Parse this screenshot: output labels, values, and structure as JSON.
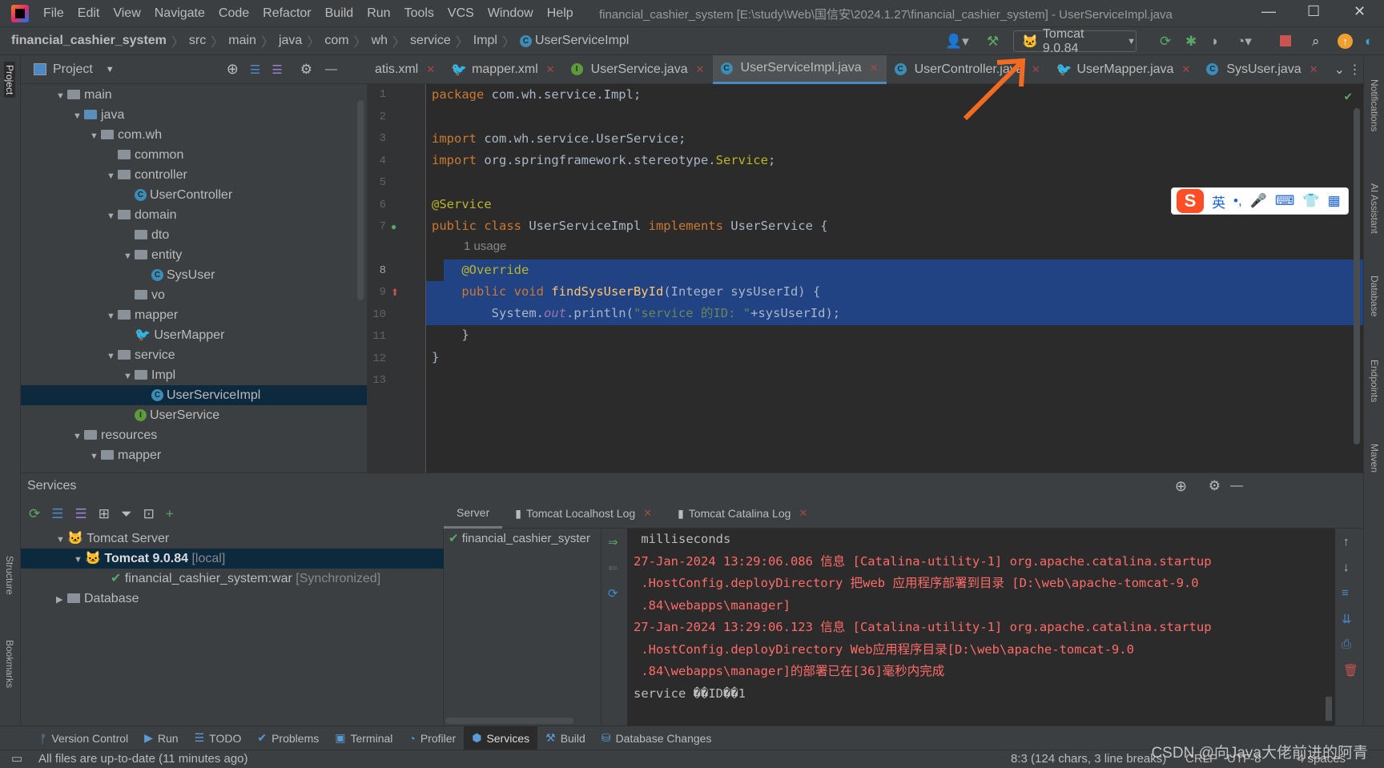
{
  "window": {
    "title": "financial_cashier_system [E:\\study\\Web\\国信安\\2024.1.27\\financial_cashier_system] - UserServiceImpl.java"
  },
  "menu": [
    "File",
    "Edit",
    "View",
    "Navigate",
    "Code",
    "Refactor",
    "Build",
    "Run",
    "Tools",
    "VCS",
    "Window",
    "Help"
  ],
  "breadcrumb": [
    "financial_cashier_system",
    "src",
    "main",
    "java",
    "com",
    "wh",
    "service",
    "Impl",
    "UserServiceImpl"
  ],
  "run_config": "Tomcat 9.0.84",
  "project_panel": {
    "title": "Project",
    "tree": [
      {
        "label": "main",
        "depth": 0,
        "type": "folder",
        "open": true
      },
      {
        "label": "java",
        "depth": 1,
        "type": "folder-blue",
        "open": true
      },
      {
        "label": "com.wh",
        "depth": 2,
        "type": "folder",
        "open": true
      },
      {
        "label": "common",
        "depth": 3,
        "type": "folder"
      },
      {
        "label": "controller",
        "depth": 3,
        "type": "folder",
        "open": true
      },
      {
        "label": "UserController",
        "depth": 4,
        "type": "class"
      },
      {
        "label": "domain",
        "depth": 3,
        "type": "folder",
        "open": true
      },
      {
        "label": "dto",
        "depth": 4,
        "type": "folder"
      },
      {
        "label": "entity",
        "depth": 4,
        "type": "folder",
        "open": true
      },
      {
        "label": "SysUser",
        "depth": 5,
        "type": "class"
      },
      {
        "label": "vo",
        "depth": 4,
        "type": "folder"
      },
      {
        "label": "mapper",
        "depth": 3,
        "type": "folder",
        "open": true
      },
      {
        "label": "UserMapper",
        "depth": 4,
        "type": "mybatis"
      },
      {
        "label": "service",
        "depth": 3,
        "type": "folder",
        "open": true
      },
      {
        "label": "Impl",
        "depth": 4,
        "type": "folder",
        "open": true
      },
      {
        "label": "UserServiceImpl",
        "depth": 5,
        "type": "class",
        "selected": true
      },
      {
        "label": "UserService",
        "depth": 4,
        "type": "interface"
      },
      {
        "label": "resources",
        "depth": 1,
        "type": "folder",
        "open": true
      },
      {
        "label": "mapper",
        "depth": 2,
        "type": "folder",
        "open": true
      }
    ]
  },
  "editor_tabs": [
    {
      "label": "atis.xml",
      "icon": "xml"
    },
    {
      "label": "mapper.xml",
      "icon": "mybatis"
    },
    {
      "label": "UserService.java",
      "icon": "interface"
    },
    {
      "label": "UserServiceImpl.java",
      "icon": "class",
      "active": true
    },
    {
      "label": "UserController.java",
      "icon": "class"
    },
    {
      "label": "UserMapper.java",
      "icon": "mybatis"
    },
    {
      "label": "SysUser.java",
      "icon": "class"
    }
  ],
  "code": {
    "usage_hint": "1 usage",
    "lines": [
      "1",
      "2",
      "3",
      "4",
      "5",
      "6",
      "7",
      "8",
      "9",
      "10",
      "11",
      "12",
      "13"
    ]
  },
  "ime": {
    "lang": "英",
    "punct": "•,"
  },
  "services": {
    "title": "Services",
    "tree": {
      "server": "Tomcat Server",
      "instance": "Tomcat 9.0.84",
      "instance_tag": "[local]",
      "artifact": "financial_cashier_system:war",
      "artifact_tag": "[Synchronized]",
      "database": "Database"
    },
    "tabs": [
      "Server",
      "Tomcat Localhost Log",
      "Tomcat Catalina Log"
    ],
    "deployment": "financial_cashier_syster",
    "console": [
      {
        "text": " milliseconds",
        "color": "normal"
      },
      {
        "text": "27-Jan-2024 13:29:06.086 信息 [Catalina-utility-1] org.apache.catalina.startup",
        "color": "red"
      },
      {
        "text": " .HostConfig.deployDirectory 把web 应用程序部署到目录 [D:\\web\\apache-tomcat-9.0",
        "color": "red"
      },
      {
        "text": " .84\\webapps\\manager]",
        "color": "red"
      },
      {
        "text": "27-Jan-2024 13:29:06.123 信息 [Catalina-utility-1] org.apache.catalina.startup",
        "color": "red"
      },
      {
        "text": " .HostConfig.deployDirectory Web应用程序目录[D:\\web\\apache-tomcat-9.0",
        "color": "red"
      },
      {
        "text": " .84\\webapps\\manager]的部署已在[36]毫秒内完成",
        "color": "red"
      },
      {
        "text": "service ��ID��1",
        "color": "normal"
      }
    ]
  },
  "tool_windows": [
    "Version Control",
    "Run",
    "TODO",
    "Problems",
    "Terminal",
    "Profiler",
    "Services",
    "Build",
    "Database Changes"
  ],
  "active_tool_window": "Services",
  "side_left": [
    "Project",
    "Structure",
    "Bookmarks"
  ],
  "side_right": [
    "Notifications",
    "AI Assistant",
    "Database",
    "Endpoints",
    "Maven"
  ],
  "status": {
    "message": "All files are up-to-date (11 minutes ago)",
    "position": "8:3 (124 chars, 3 line breaks)",
    "line_sep": "CRLF",
    "encoding": "UTF-8",
    "indent": "4 spaces"
  },
  "watermark": "CSDN @向Java大佬前进的阿青",
  "colors": {
    "accent": "#4a88c7",
    "selection": "#214283",
    "error_text": "#ff6b68",
    "annotation_arrow": "#f26b21"
  }
}
